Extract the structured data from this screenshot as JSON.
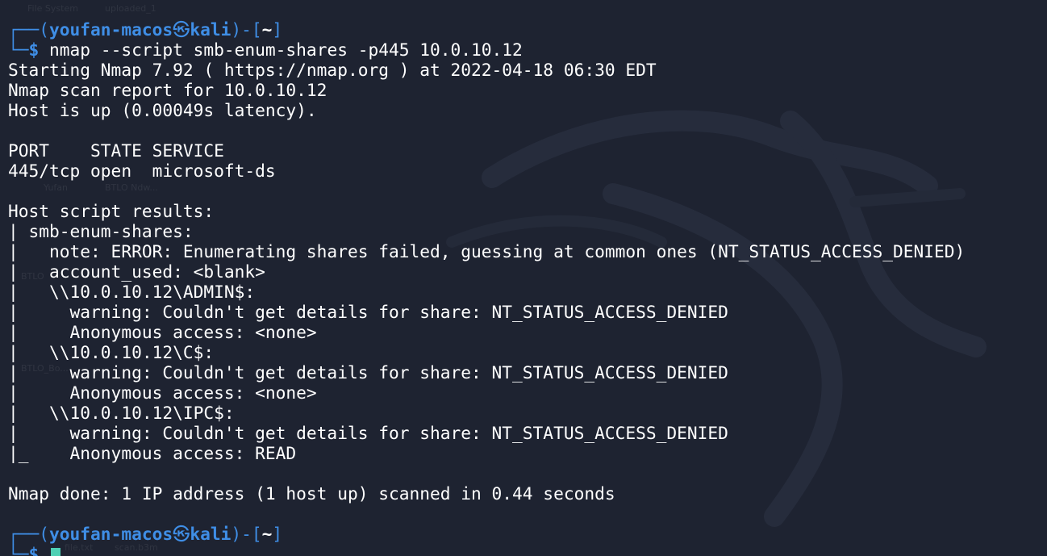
{
  "desktop_labels": [
    "File System",
    "uploaded_1",
    "Yufan",
    "BTLO Ndw...",
    "BTLO",
    "BTLO_Bo...",
    "file.txt",
    "scan.b3m"
  ],
  "prompt": {
    "top_left": "┌──(",
    "user_host": "youfan-macos",
    "sep_icon": "㉿",
    "host": "kali",
    "close_bracket": ")-[",
    "cwd": "~",
    "end_bracket": "]",
    "bottom_left": "└─",
    "dollar": "$"
  },
  "command": " nmap --script smb-enum-shares -p445 10.0.10.12",
  "output": [
    "Starting Nmap 7.92 ( https://nmap.org ) at 2022-04-18 06:30 EDT",
    "Nmap scan report for 10.0.10.12",
    "Host is up (0.00049s latency).",
    "",
    "PORT    STATE SERVICE",
    "445/tcp open  microsoft-ds",
    "",
    "Host script results:",
    "| smb-enum-shares:",
    "|   note: ERROR: Enumerating shares failed, guessing at common ones (NT_STATUS_ACCESS_DENIED)",
    "|   account_used: <blank>",
    "|   \\\\10.0.10.12\\ADMIN$:",
    "|     warning: Couldn't get details for share: NT_STATUS_ACCESS_DENIED",
    "|     Anonymous access: <none>",
    "|   \\\\10.0.10.12\\C$:",
    "|     warning: Couldn't get details for share: NT_STATUS_ACCESS_DENIED",
    "|     Anonymous access: <none>",
    "|   \\\\10.0.10.12\\IPC$:",
    "|     warning: Couldn't get details for share: NT_STATUS_ACCESS_DENIED",
    "|_    Anonymous access: READ",
    "",
    "Nmap done: 1 IP address (1 host up) scanned in 0.44 seconds"
  ],
  "colors": {
    "background": "#1e2331",
    "prompt_blue": "#3f8ee6",
    "text": "#ffffff",
    "cursor": "#4fd0b4"
  }
}
